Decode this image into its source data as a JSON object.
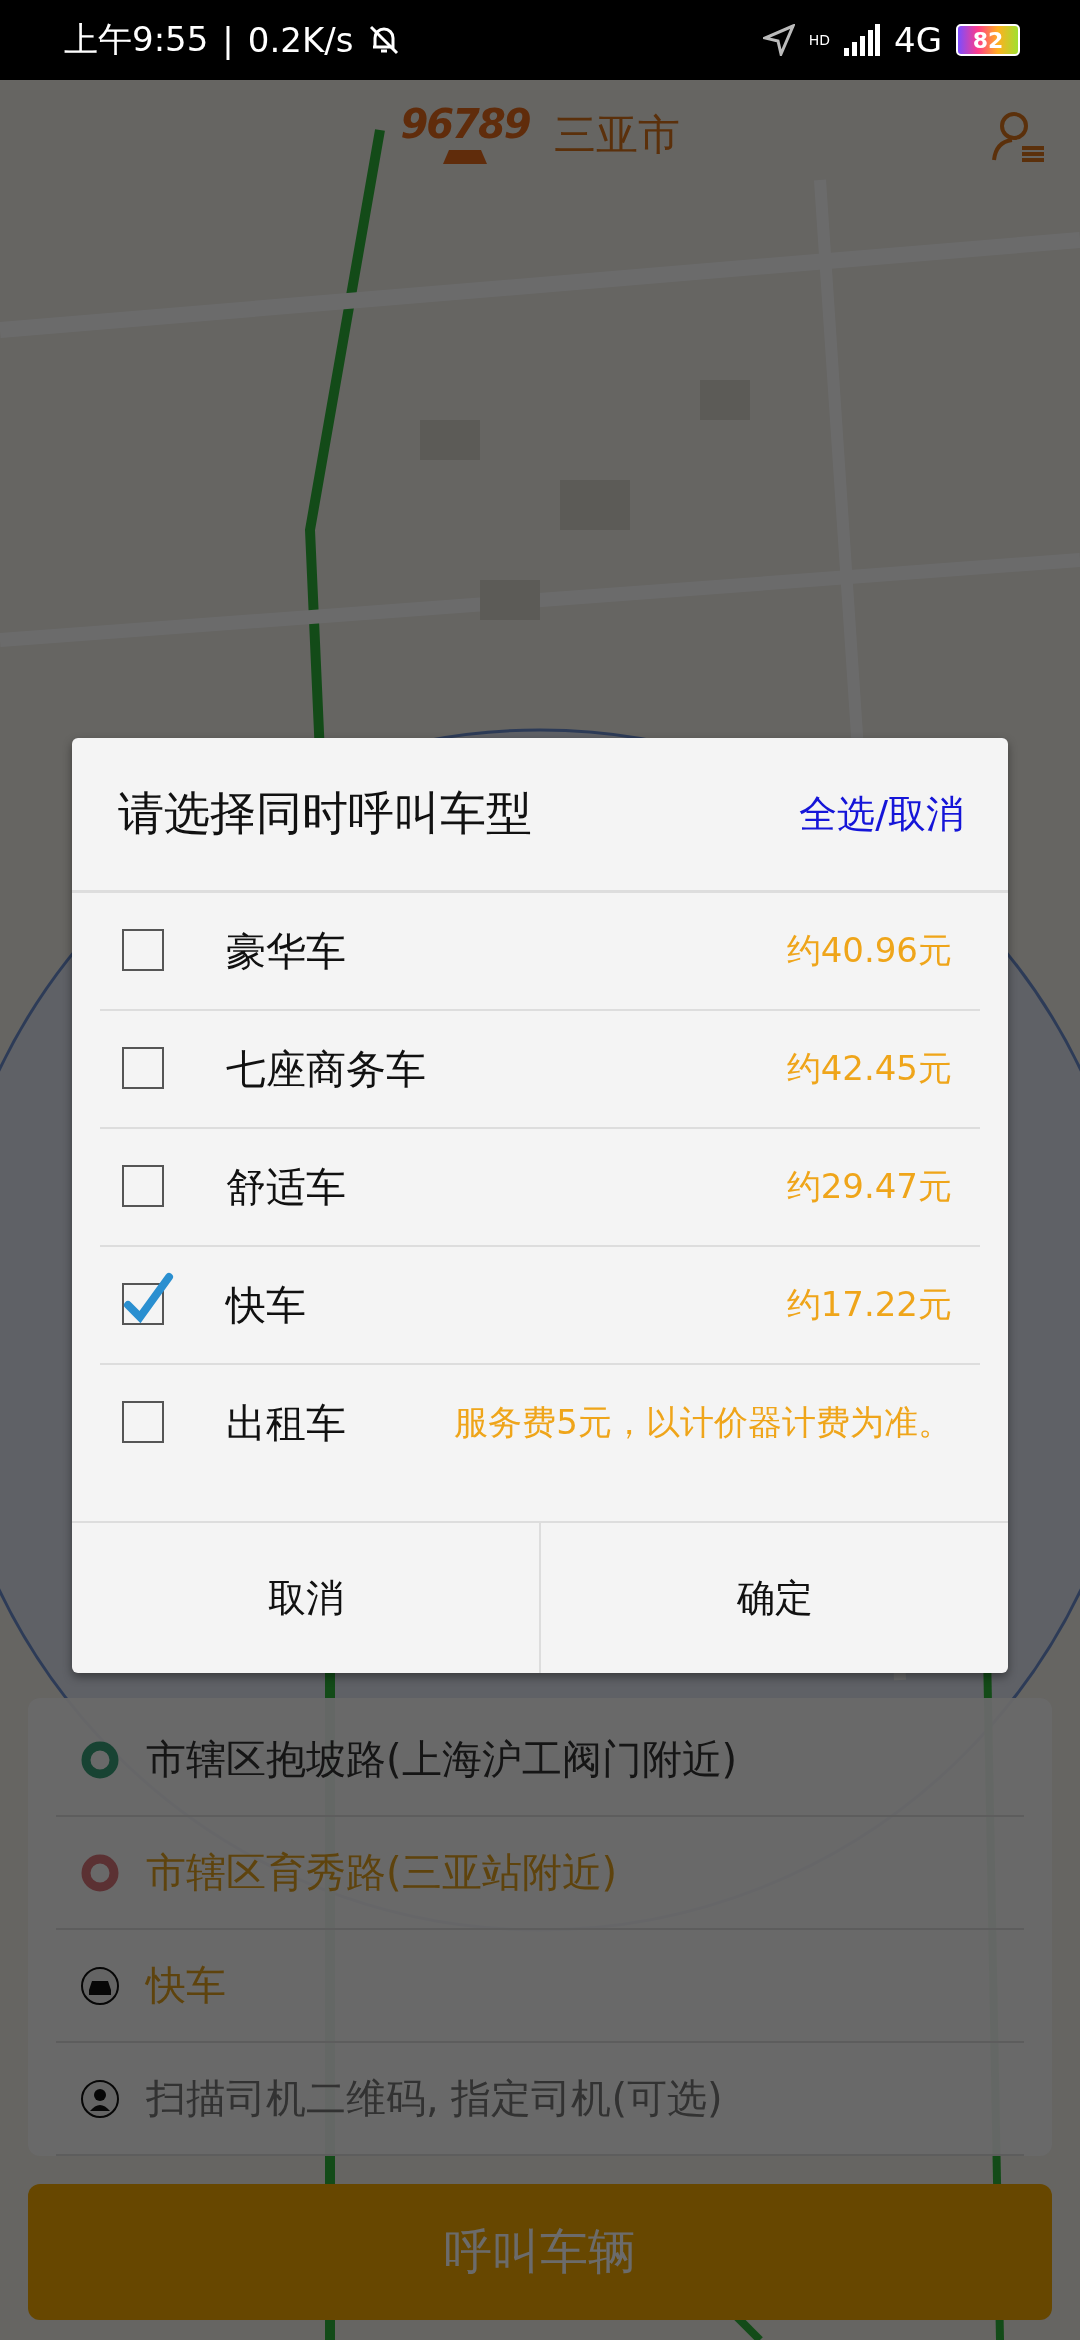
{
  "status_bar": {
    "time": "上午9:55",
    "separator": "|",
    "speed": "0.2K/s",
    "hd": "HD",
    "network": "4G",
    "battery": "82"
  },
  "header": {
    "logo": "96789",
    "city": "三亚市"
  },
  "trip_panel": {
    "rows": [
      {
        "kind": "start",
        "text": "市辖区抱坡路(上海沪工阀门附近)"
      },
      {
        "kind": "destination",
        "text": "市辖区育秀路(三亚站附近)"
      },
      {
        "kind": "car_type",
        "text": "快车"
      },
      {
        "kind": "driver",
        "placeholder": "扫描司机二维码, 指定司机(可选)"
      }
    ]
  },
  "call_button": "呼叫车辆",
  "dialog": {
    "title": "请选择同时呼叫车型",
    "select_all": "全选/取消",
    "options": [
      {
        "label": "豪华车",
        "price": "约40.96元",
        "checked": false
      },
      {
        "label": "七座商务车",
        "price": "约42.45元",
        "checked": false
      },
      {
        "label": "舒适车",
        "price": "约29.47元",
        "checked": false
      },
      {
        "label": "快车",
        "price": "约17.22元",
        "checked": true
      },
      {
        "label": "出租车",
        "price": "服务费5元，以计价器计费为准。",
        "checked": false
      }
    ],
    "buttons": [
      "取消",
      "确定"
    ]
  }
}
